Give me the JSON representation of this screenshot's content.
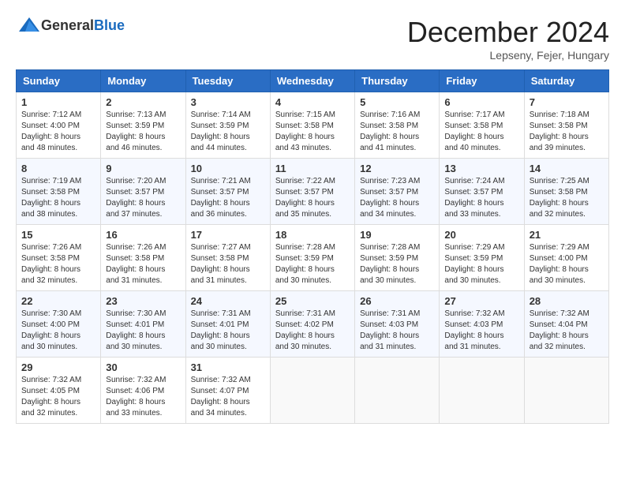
{
  "logo": {
    "general": "General",
    "blue": "Blue"
  },
  "header": {
    "month": "December 2024",
    "location": "Lepseny, Fejer, Hungary"
  },
  "weekdays": [
    "Sunday",
    "Monday",
    "Tuesday",
    "Wednesday",
    "Thursday",
    "Friday",
    "Saturday"
  ],
  "weeks": [
    [
      {
        "day": "1",
        "sunrise": "7:12 AM",
        "sunset": "4:00 PM",
        "daylight": "8 hours and 48 minutes."
      },
      {
        "day": "2",
        "sunrise": "7:13 AM",
        "sunset": "3:59 PM",
        "daylight": "8 hours and 46 minutes."
      },
      {
        "day": "3",
        "sunrise": "7:14 AM",
        "sunset": "3:59 PM",
        "daylight": "8 hours and 44 minutes."
      },
      {
        "day": "4",
        "sunrise": "7:15 AM",
        "sunset": "3:58 PM",
        "daylight": "8 hours and 43 minutes."
      },
      {
        "day": "5",
        "sunrise": "7:16 AM",
        "sunset": "3:58 PM",
        "daylight": "8 hours and 41 minutes."
      },
      {
        "day": "6",
        "sunrise": "7:17 AM",
        "sunset": "3:58 PM",
        "daylight": "8 hours and 40 minutes."
      },
      {
        "day": "7",
        "sunrise": "7:18 AM",
        "sunset": "3:58 PM",
        "daylight": "8 hours and 39 minutes."
      }
    ],
    [
      {
        "day": "8",
        "sunrise": "7:19 AM",
        "sunset": "3:58 PM",
        "daylight": "8 hours and 38 minutes."
      },
      {
        "day": "9",
        "sunrise": "7:20 AM",
        "sunset": "3:57 PM",
        "daylight": "8 hours and 37 minutes."
      },
      {
        "day": "10",
        "sunrise": "7:21 AM",
        "sunset": "3:57 PM",
        "daylight": "8 hours and 36 minutes."
      },
      {
        "day": "11",
        "sunrise": "7:22 AM",
        "sunset": "3:57 PM",
        "daylight": "8 hours and 35 minutes."
      },
      {
        "day": "12",
        "sunrise": "7:23 AM",
        "sunset": "3:57 PM",
        "daylight": "8 hours and 34 minutes."
      },
      {
        "day": "13",
        "sunrise": "7:24 AM",
        "sunset": "3:57 PM",
        "daylight": "8 hours and 33 minutes."
      },
      {
        "day": "14",
        "sunrise": "7:25 AM",
        "sunset": "3:58 PM",
        "daylight": "8 hours and 32 minutes."
      }
    ],
    [
      {
        "day": "15",
        "sunrise": "7:26 AM",
        "sunset": "3:58 PM",
        "daylight": "8 hours and 32 minutes."
      },
      {
        "day": "16",
        "sunrise": "7:26 AM",
        "sunset": "3:58 PM",
        "daylight": "8 hours and 31 minutes."
      },
      {
        "day": "17",
        "sunrise": "7:27 AM",
        "sunset": "3:58 PM",
        "daylight": "8 hours and 31 minutes."
      },
      {
        "day": "18",
        "sunrise": "7:28 AM",
        "sunset": "3:59 PM",
        "daylight": "8 hours and 30 minutes."
      },
      {
        "day": "19",
        "sunrise": "7:28 AM",
        "sunset": "3:59 PM",
        "daylight": "8 hours and 30 minutes."
      },
      {
        "day": "20",
        "sunrise": "7:29 AM",
        "sunset": "3:59 PM",
        "daylight": "8 hours and 30 minutes."
      },
      {
        "day": "21",
        "sunrise": "7:29 AM",
        "sunset": "4:00 PM",
        "daylight": "8 hours and 30 minutes."
      }
    ],
    [
      {
        "day": "22",
        "sunrise": "7:30 AM",
        "sunset": "4:00 PM",
        "daylight": "8 hours and 30 minutes."
      },
      {
        "day": "23",
        "sunrise": "7:30 AM",
        "sunset": "4:01 PM",
        "daylight": "8 hours and 30 minutes."
      },
      {
        "day": "24",
        "sunrise": "7:31 AM",
        "sunset": "4:01 PM",
        "daylight": "8 hours and 30 minutes."
      },
      {
        "day": "25",
        "sunrise": "7:31 AM",
        "sunset": "4:02 PM",
        "daylight": "8 hours and 30 minutes."
      },
      {
        "day": "26",
        "sunrise": "7:31 AM",
        "sunset": "4:03 PM",
        "daylight": "8 hours and 31 minutes."
      },
      {
        "day": "27",
        "sunrise": "7:32 AM",
        "sunset": "4:03 PM",
        "daylight": "8 hours and 31 minutes."
      },
      {
        "day": "28",
        "sunrise": "7:32 AM",
        "sunset": "4:04 PM",
        "daylight": "8 hours and 32 minutes."
      }
    ],
    [
      {
        "day": "29",
        "sunrise": "7:32 AM",
        "sunset": "4:05 PM",
        "daylight": "8 hours and 32 minutes."
      },
      {
        "day": "30",
        "sunrise": "7:32 AM",
        "sunset": "4:06 PM",
        "daylight": "8 hours and 33 minutes."
      },
      {
        "day": "31",
        "sunrise": "7:32 AM",
        "sunset": "4:07 PM",
        "daylight": "8 hours and 34 minutes."
      },
      null,
      null,
      null,
      null
    ]
  ]
}
